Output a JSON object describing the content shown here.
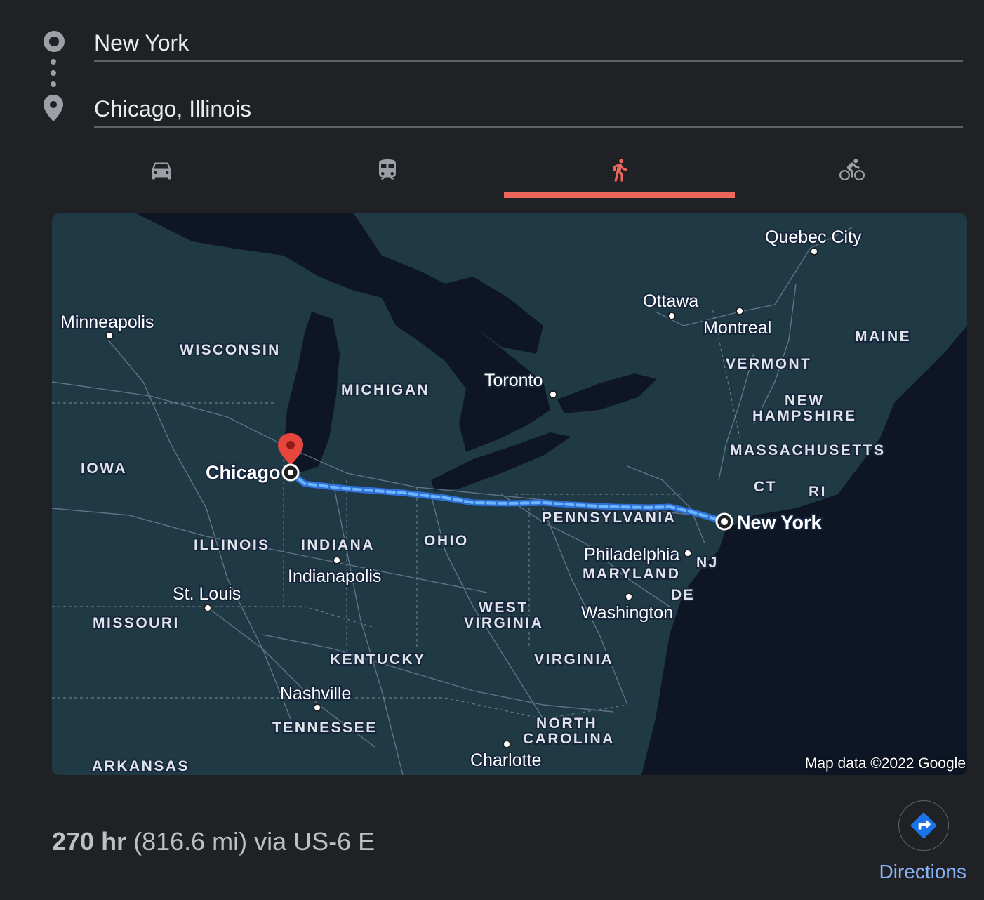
{
  "origin": {
    "value": "New York",
    "icon": "origin-circle-icon"
  },
  "destination": {
    "value": "Chicago, Illinois",
    "icon": "place-pin-icon"
  },
  "travel_modes": [
    {
      "name": "driving",
      "icon": "car-icon",
      "active": false
    },
    {
      "name": "transit",
      "icon": "train-icon",
      "active": false
    },
    {
      "name": "walking",
      "icon": "walk-icon",
      "active": true
    },
    {
      "name": "cycling",
      "icon": "bicycle-icon",
      "active": false
    }
  ],
  "colors": {
    "background": "#202124",
    "accent": "#ee675c",
    "route": "#4ea1ff",
    "link": "#8ab4f8",
    "water": "#0e1626",
    "land": "#1f3a44"
  },
  "map": {
    "attribution": "Map data ©2022 Google",
    "cities": [
      "Quebec City",
      "Ottawa",
      "Montreal",
      "Minneapolis",
      "Toronto",
      "Indianapolis",
      "St. Louis",
      "Philadelphia",
      "Washington",
      "Nashville",
      "Charlotte"
    ],
    "states": [
      "MAINE",
      "VERMONT",
      "WISCONSIN",
      "MICHIGAN",
      "NEW",
      "HAMPSHIRE",
      "MASSACHUSETTS",
      "IOWA",
      "CT",
      "RI",
      "PENNSYLVANIA",
      "ILLINOIS",
      "INDIANA",
      "OHIO",
      "NJ",
      "MARYLAND",
      "DE",
      "WEST",
      "VIRGINIA",
      "MISSOURI",
      "KENTUCKY",
      "VIRGINIA",
      "TENNESSEE",
      "NORTH",
      "CAROLINA",
      "ARKANSAS"
    ],
    "route_start": "Chicago",
    "route_end": "New York"
  },
  "summary": {
    "duration": "270 hr",
    "details": " (816.6 mi) via US-6 E"
  },
  "directions": {
    "label": "Directions",
    "icon": "directions-arrow-icon"
  }
}
